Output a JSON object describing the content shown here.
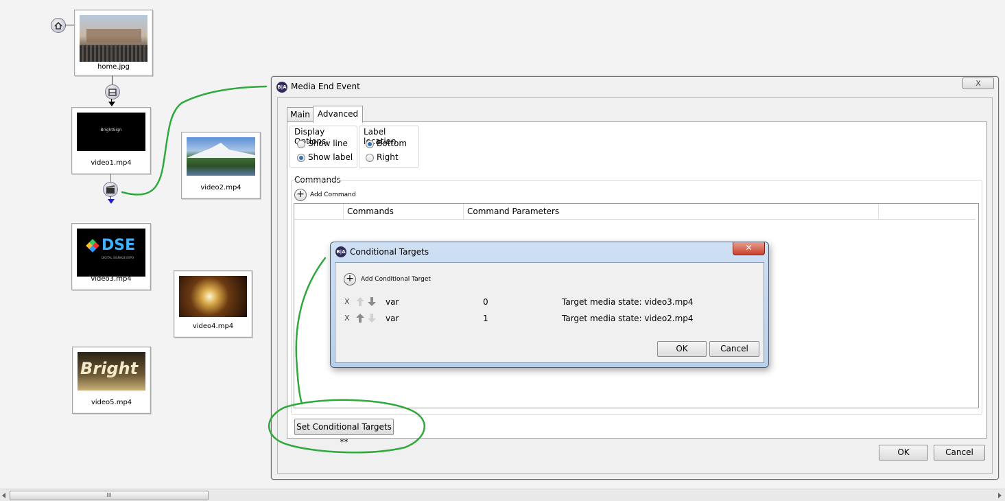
{
  "canvas": {
    "tiles": [
      {
        "id": "home",
        "caption": "home.jpg"
      },
      {
        "id": "video1",
        "caption": "video1.mp4",
        "thumb_text": "BrightSign"
      },
      {
        "id": "video2",
        "caption": "video2.mp4"
      },
      {
        "id": "video3",
        "caption": "video3.mp4",
        "thumb_text": "DSE",
        "thumb_subtext": "DIGITAL SIGNAGE EXPO"
      },
      {
        "id": "video4",
        "caption": "video4.mp4"
      },
      {
        "id": "video5",
        "caption": "video5.mp4",
        "thumb_text": "Bright"
      }
    ],
    "scrollbar_grip": "III"
  },
  "media_end_dialog": {
    "title": "Media End Event",
    "close_glyph": "X",
    "logo_text": "B|A",
    "tabs": [
      {
        "label": "Main"
      },
      {
        "label": "Advanced"
      }
    ],
    "display_options": {
      "legend": "Display Options",
      "show_line": "Show line",
      "show_label": "Show label"
    },
    "label_location": {
      "legend": "Label location",
      "bottom": "Bottom",
      "right": "Right"
    },
    "commands": {
      "legend": "Commands",
      "add_command": "Add Command",
      "columns": [
        "Commands",
        "Command Parameters"
      ]
    },
    "set_targets_button": "Set Conditional Targets **",
    "ok": "OK",
    "cancel": "Cancel"
  },
  "conditional_dialog": {
    "title": "Conditional Targets",
    "close_glyph": "✕",
    "logo_text": "B|A",
    "add_target": "Add Conditional Target",
    "rows": [
      {
        "remove": "X",
        "var": "var",
        "value": "0",
        "target": "Target media state: video3.mp4"
      },
      {
        "remove": "X",
        "var": "var",
        "value": "1",
        "target": "Target media state: video2.mp4"
      }
    ],
    "ok": "OK",
    "cancel": "Cancel"
  },
  "colors": {
    "annotation": "#2fa83c",
    "accent": "#2f6fb6"
  }
}
